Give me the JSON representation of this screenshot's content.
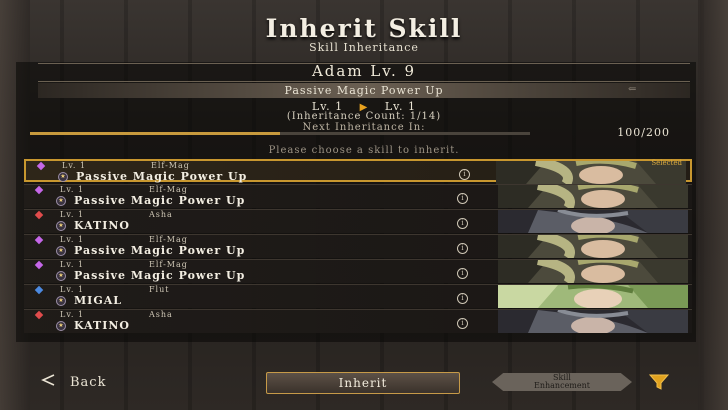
{
  "header": {
    "title": "Inherit Skill",
    "subtitle": "Skill Inheritance"
  },
  "character": {
    "name_level": "Adam   Lv.  9"
  },
  "skill": {
    "name": "Passive Magic Power Up",
    "level_from": "Lv. 1",
    "level_to": "Lv. 1",
    "inheritance_count": "(Inheritance Count: 1/14)",
    "next_label": "Next Inheritance In:",
    "progress_text": "100/200",
    "progress_fraction": 0.5
  },
  "prompt": "Please choose a skill to inherit.",
  "selected_label": "Selected",
  "rows": [
    {
      "level": "Lv. 1",
      "class": "Elf-Mag",
      "name": "Passive Magic Power Up",
      "gem_color": "#c567e8",
      "portrait": "elf-green",
      "selected": true
    },
    {
      "level": "Lv. 1",
      "class": "Elf-Mag",
      "name": "Passive Magic Power Up",
      "gem_color": "#c567e8",
      "portrait": "elf-green",
      "selected": false
    },
    {
      "level": "Lv. 1",
      "class": "Asha",
      "name": "KATINO",
      "gem_color": "#e04c4c",
      "portrait": "asha-dark",
      "selected": false
    },
    {
      "level": "Lv. 1",
      "class": "Elf-Mag",
      "name": "Passive Magic Power Up",
      "gem_color": "#c567e8",
      "portrait": "elf-green",
      "selected": false
    },
    {
      "level": "Lv. 1",
      "class": "Elf-Mag",
      "name": "Passive Magic Power Up",
      "gem_color": "#c567e8",
      "portrait": "elf-green",
      "selected": false
    },
    {
      "level": "Lv. 1",
      "class": "Flut",
      "name": "MIGAL",
      "gem_color": "#4c8ae0",
      "portrait": "flut-green",
      "selected": false
    },
    {
      "level": "Lv. 1",
      "class": "Asha",
      "name": "KATINO",
      "gem_color": "#e04c4c",
      "portrait": "asha-dark",
      "selected": false
    }
  ],
  "footer": {
    "back_label": "Back",
    "inherit_label": "Inherit",
    "enhancement_line1": "Skill",
    "enhancement_line2": "Enhancement"
  },
  "icons": {
    "back": "back-arrow-icon",
    "filter": "filter-funnel-icon",
    "info": "info-icon",
    "skill": "skill-star-icon"
  }
}
